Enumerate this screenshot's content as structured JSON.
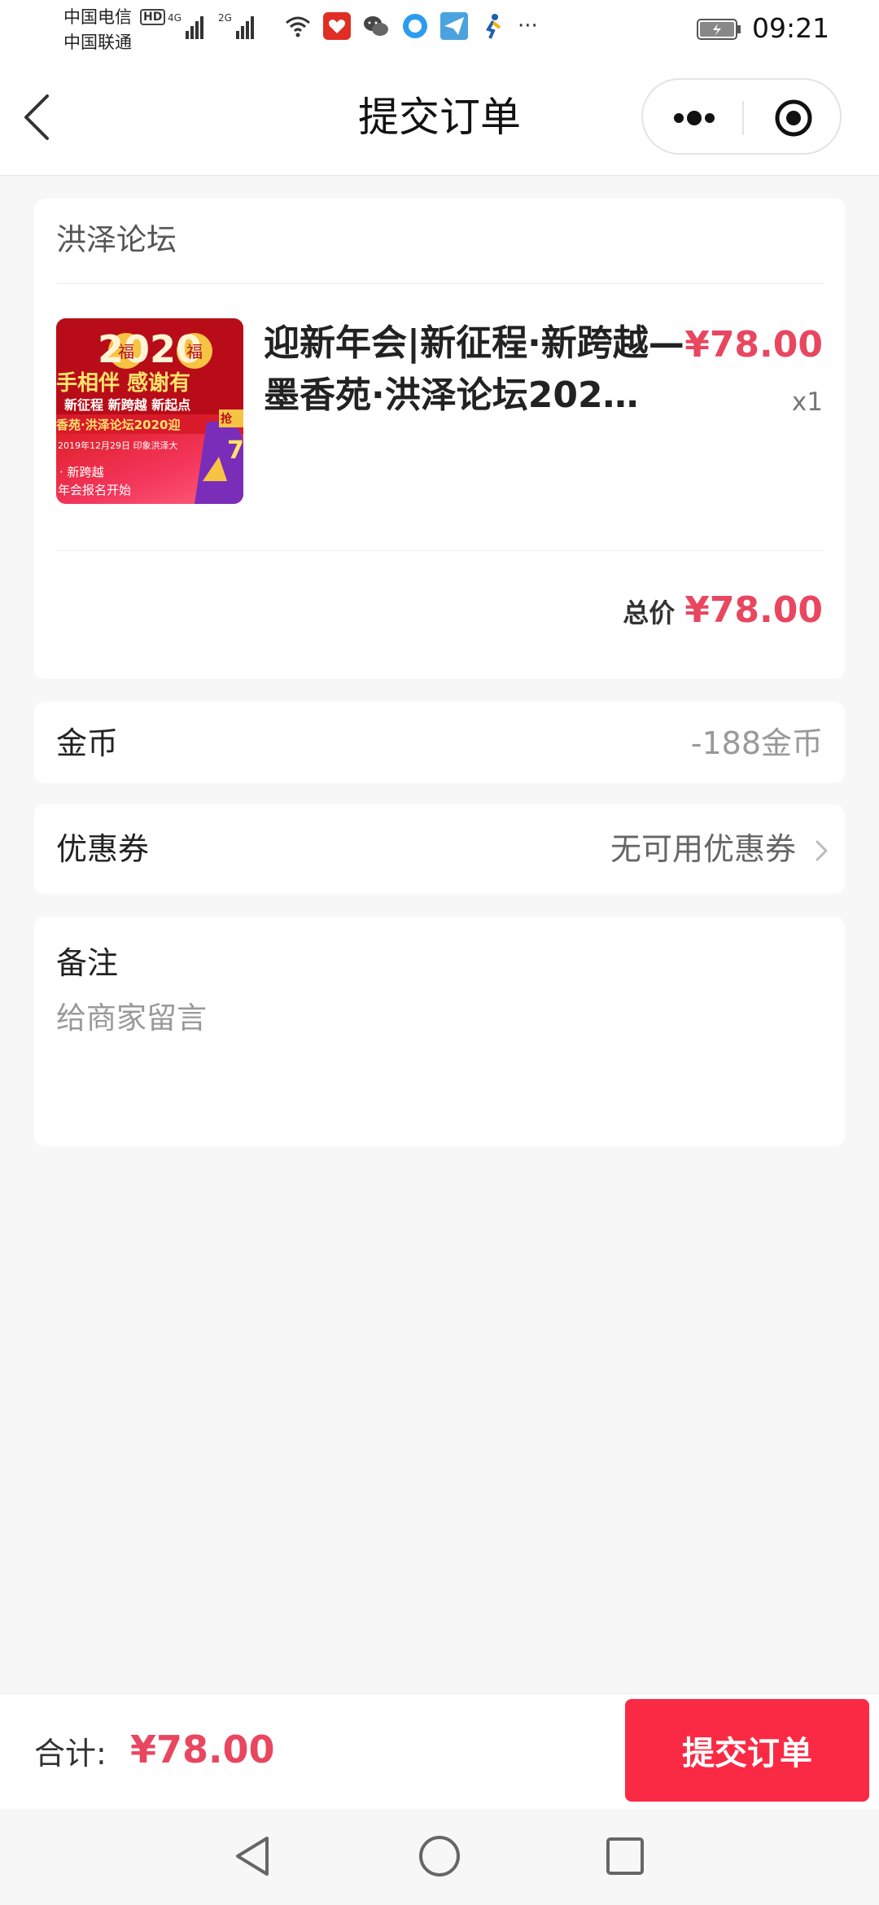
{
  "status_bar": {
    "carrier_1": "中国电信",
    "carrier_2": "中国联通",
    "hd_badge": "HD",
    "net_1": "4G",
    "net_2": "2G",
    "more": "···",
    "time": "09:21"
  },
  "nav": {
    "title": "提交订单",
    "back_icon": "chevron-left-icon",
    "more_icon": "more-dots-icon",
    "close_icon": "record-close-icon"
  },
  "order": {
    "shop_name": "洪泽论坛",
    "product": {
      "title": "迎新年会|新征程·新跨越—墨香苑·洪泽论坛202…",
      "price": "¥78.00",
      "quantity": "x1",
      "thumb": {
        "year": "2020",
        "fu": "福",
        "slogan": "手相伴 感谢有",
        "subline": "新征程 新跨越 新起点",
        "event": "香苑·洪泽论坛2020迎",
        "date": "2019年12月29日 印象洪泽大",
        "tag_1": "· 新跨越",
        "tag_2": "年会报名开始",
        "badge": "抢",
        "badge_num": "7"
      }
    },
    "total_label": "总价",
    "total_value": "¥78.00"
  },
  "coins": {
    "label": "金币",
    "value": "-188金币"
  },
  "coupon": {
    "label": "优惠券",
    "value": "无可用优惠券"
  },
  "note": {
    "label": "备注",
    "placeholder": "给商家留言",
    "value": ""
  },
  "footer": {
    "sum_label": "合计:",
    "sum_value": "¥78.00",
    "submit_label": "提交订单"
  },
  "colors": {
    "accent": "#fa2a44",
    "price": "#e94660",
    "background": "#f7f7f7"
  }
}
